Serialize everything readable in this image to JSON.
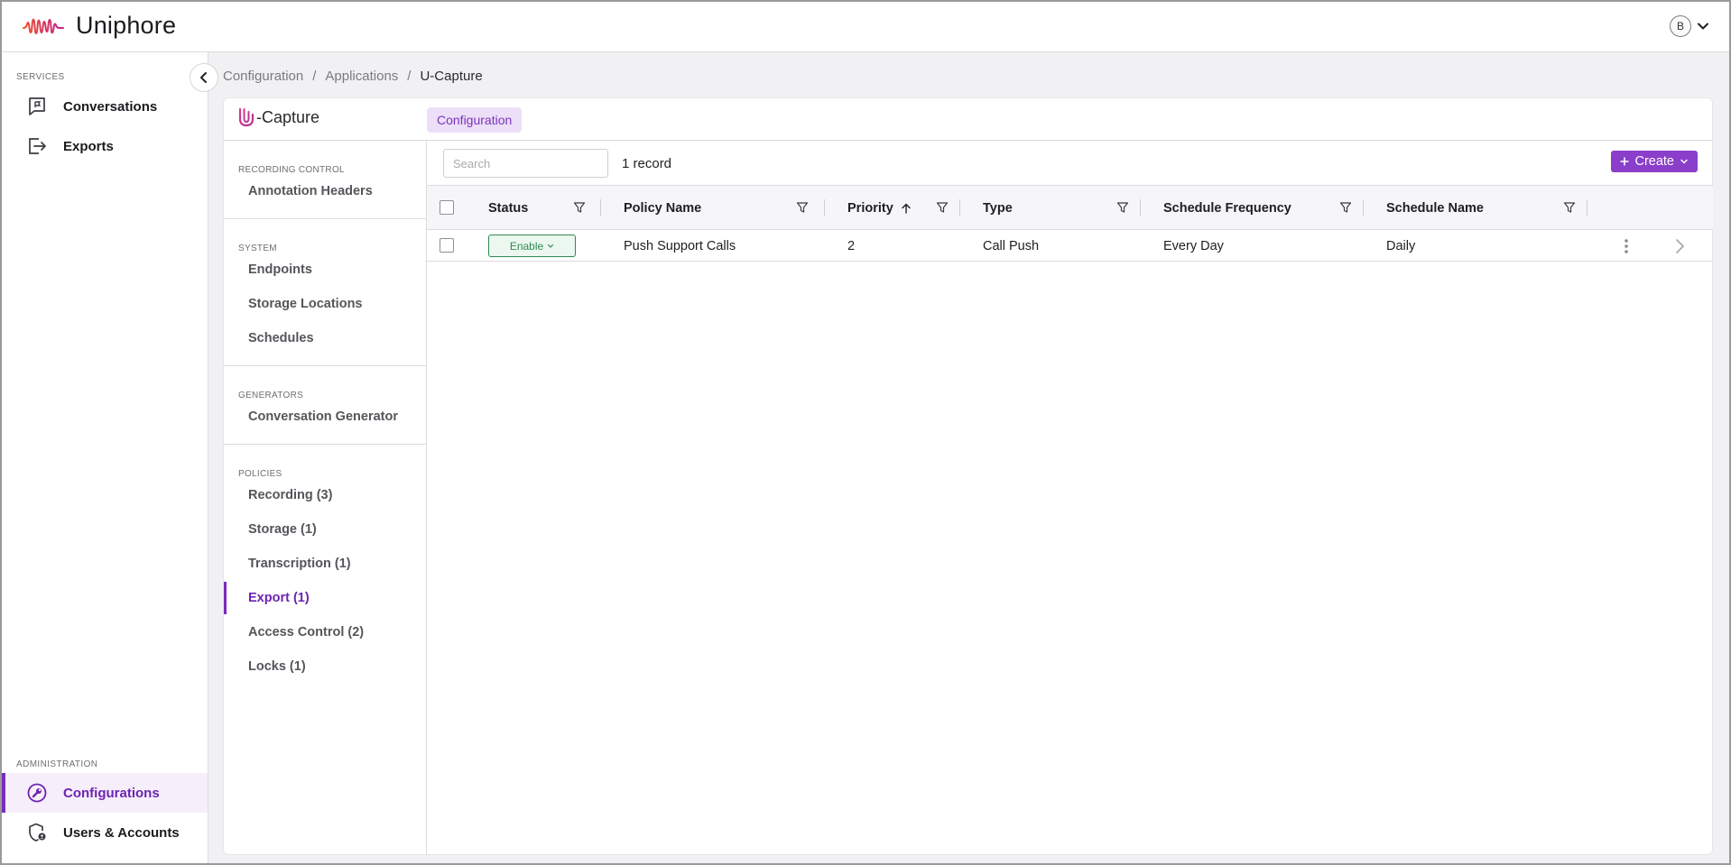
{
  "app": {
    "brand_name": "Uniphore",
    "user_initial": "B"
  },
  "sidebar": {
    "services_title": "SERVICES",
    "services": [
      {
        "label": "Conversations",
        "icon": "chat-icon"
      },
      {
        "label": "Exports",
        "icon": "export-icon"
      }
    ],
    "admin_title": "ADMINISTRATION",
    "admin": [
      {
        "label": "Configurations",
        "icon": "wrench-icon",
        "active": true
      },
      {
        "label": "Users & Accounts",
        "icon": "user-shield-icon"
      }
    ]
  },
  "breadcrumb": {
    "items": [
      "Configuration",
      "Applications"
    ],
    "current": "U-Capture",
    "separator": "/"
  },
  "card": {
    "app_name": "-Capture",
    "tab_label": "Configuration"
  },
  "innernav": {
    "groups": [
      {
        "title": "RECORDING CONTROL",
        "items": [
          "Annotation Headers"
        ]
      },
      {
        "title": "SYSTEM",
        "items": [
          "Endpoints",
          "Storage Locations",
          "Schedules"
        ]
      },
      {
        "title": "GENERATORS",
        "items": [
          "Conversation Generator"
        ]
      },
      {
        "title": "POLICIES",
        "items": [
          "Recording (3)",
          "Storage (1)",
          "Transcription (1)",
          "Export (1)",
          "Access Control (2)",
          "Locks (1)"
        ]
      }
    ],
    "active_item": "Export (1)"
  },
  "table": {
    "search_placeholder": "Search",
    "record_count": "1 record",
    "create_label": "Create",
    "columns": [
      "Status",
      "Policy Name",
      "Priority",
      "Type",
      "Schedule Frequency",
      "Schedule Name"
    ],
    "sorted_column": "Priority",
    "sort_direction": "ascending",
    "rows": [
      {
        "status": "Enable",
        "policy_name": "Push Support Calls",
        "priority": "2",
        "type": "Call Push",
        "schedule_frequency": "Every Day",
        "schedule_name": "Daily"
      }
    ]
  },
  "colors": {
    "accent": "#7a2cba",
    "accent_light": "#ecdff7",
    "create_button": "#8a3ec9",
    "status_green": "#2e8a52",
    "logo_gradient_start": "#f0512b",
    "logo_gradient_end": "#c0218d"
  }
}
